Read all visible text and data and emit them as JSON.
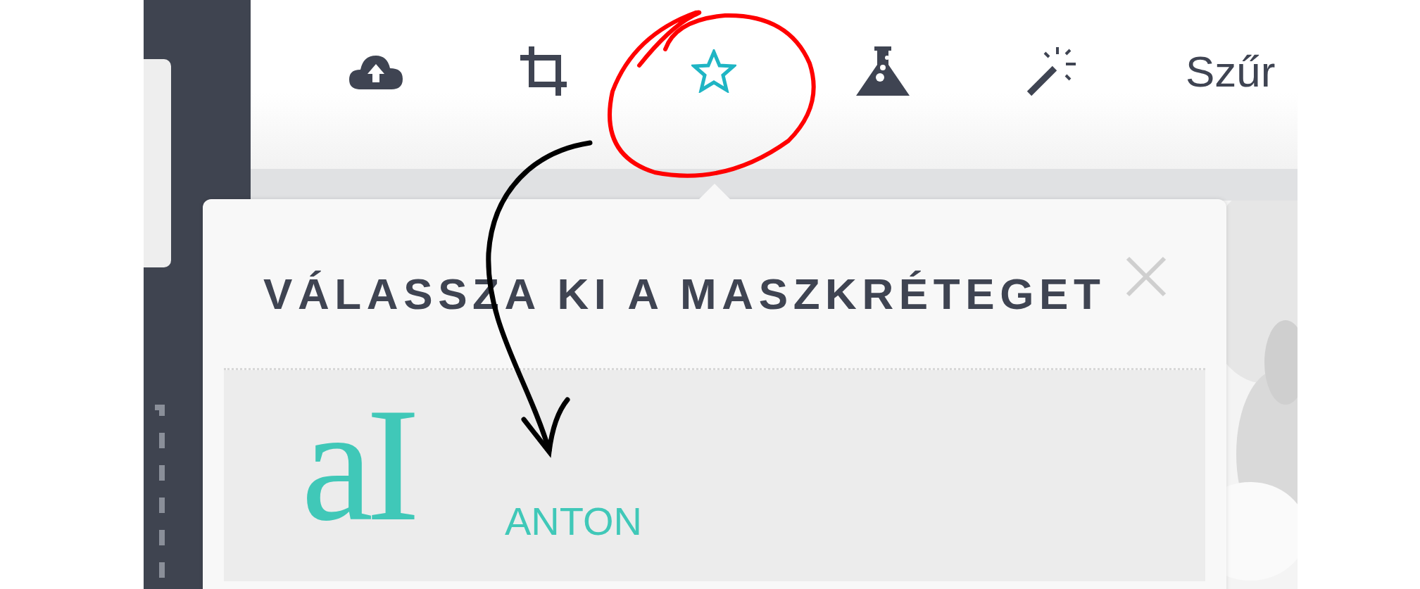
{
  "toolbar": {
    "tools": [
      {
        "kind": "upload",
        "selected": false
      },
      {
        "kind": "crop",
        "selected": false
      },
      {
        "kind": "star",
        "selected": true
      },
      {
        "kind": "flask",
        "selected": false
      },
      {
        "kind": "wand",
        "selected": false
      },
      {
        "kind": "text",
        "label": "Szűr",
        "selected": false
      }
    ]
  },
  "popup": {
    "title": "VÁLASSZA KI A MASZKRÉTEGET",
    "items": [
      {
        "logo": "aI",
        "name": "ANTON"
      }
    ]
  }
}
